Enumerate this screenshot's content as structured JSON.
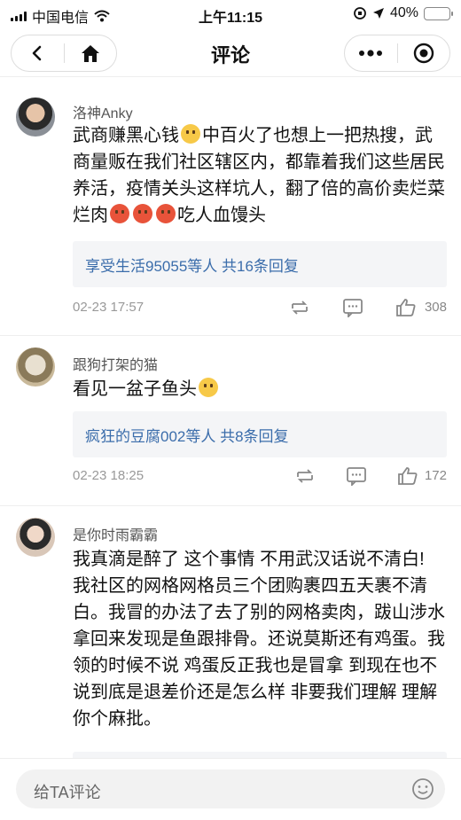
{
  "status_bar": {
    "carrier": "中国电信",
    "time": "上午11:15",
    "battery": "40%",
    "battery_level": 0.4
  },
  "nav": {
    "title": "评论",
    "back_icon": "chevron-left-icon",
    "home_icon": "home-icon",
    "more_icon": "more-dots-icon",
    "close_icon": "record-target-icon"
  },
  "comments": [
    {
      "username": "洛神Anky",
      "segments": [
        "武商赚黑心钱",
        "中百火了也想上一把热搜，武商量贩在我们社区辖区内，都靠着我们这些居民养活，疫情关头这样坑人，翻了倍的高价卖烂菜烂肉",
        "吃人血馒头"
      ],
      "replies": "享受生活95055等人 共16条回复",
      "date": "02-23 17:57",
      "likes": "308"
    },
    {
      "username": "跟狗打架的猫",
      "segments": [
        "看见一盆子鱼头"
      ],
      "replies": "疯狂的豆腐002等人 共8条回复",
      "date": "02-23 18:25",
      "likes": "172"
    },
    {
      "username": "是你时雨霸霸",
      "segments": [
        "我真滴是醉了 这个事情 不用武汉话说不清白! 我社区的网格网格员三个团购裹四五天裹不清白。我冒的办法了去了别的网格卖肉，跋山涉水拿回来发现是鱼跟排骨。还说莫斯还有鸡蛋。我领的时候不说 鸡蛋反正我也是冒拿 到现在也不说到底是退差价还是怎么样 非要我们理解 理解你个麻批。"
      ]
    }
  ],
  "input": {
    "placeholder": "给TA评论",
    "emoji_icon": "smiley-icon"
  },
  "colors": {
    "link": "#3b6dab",
    "battery_fill": "#f5c518",
    "reply_bg": "#f4f5f7"
  }
}
